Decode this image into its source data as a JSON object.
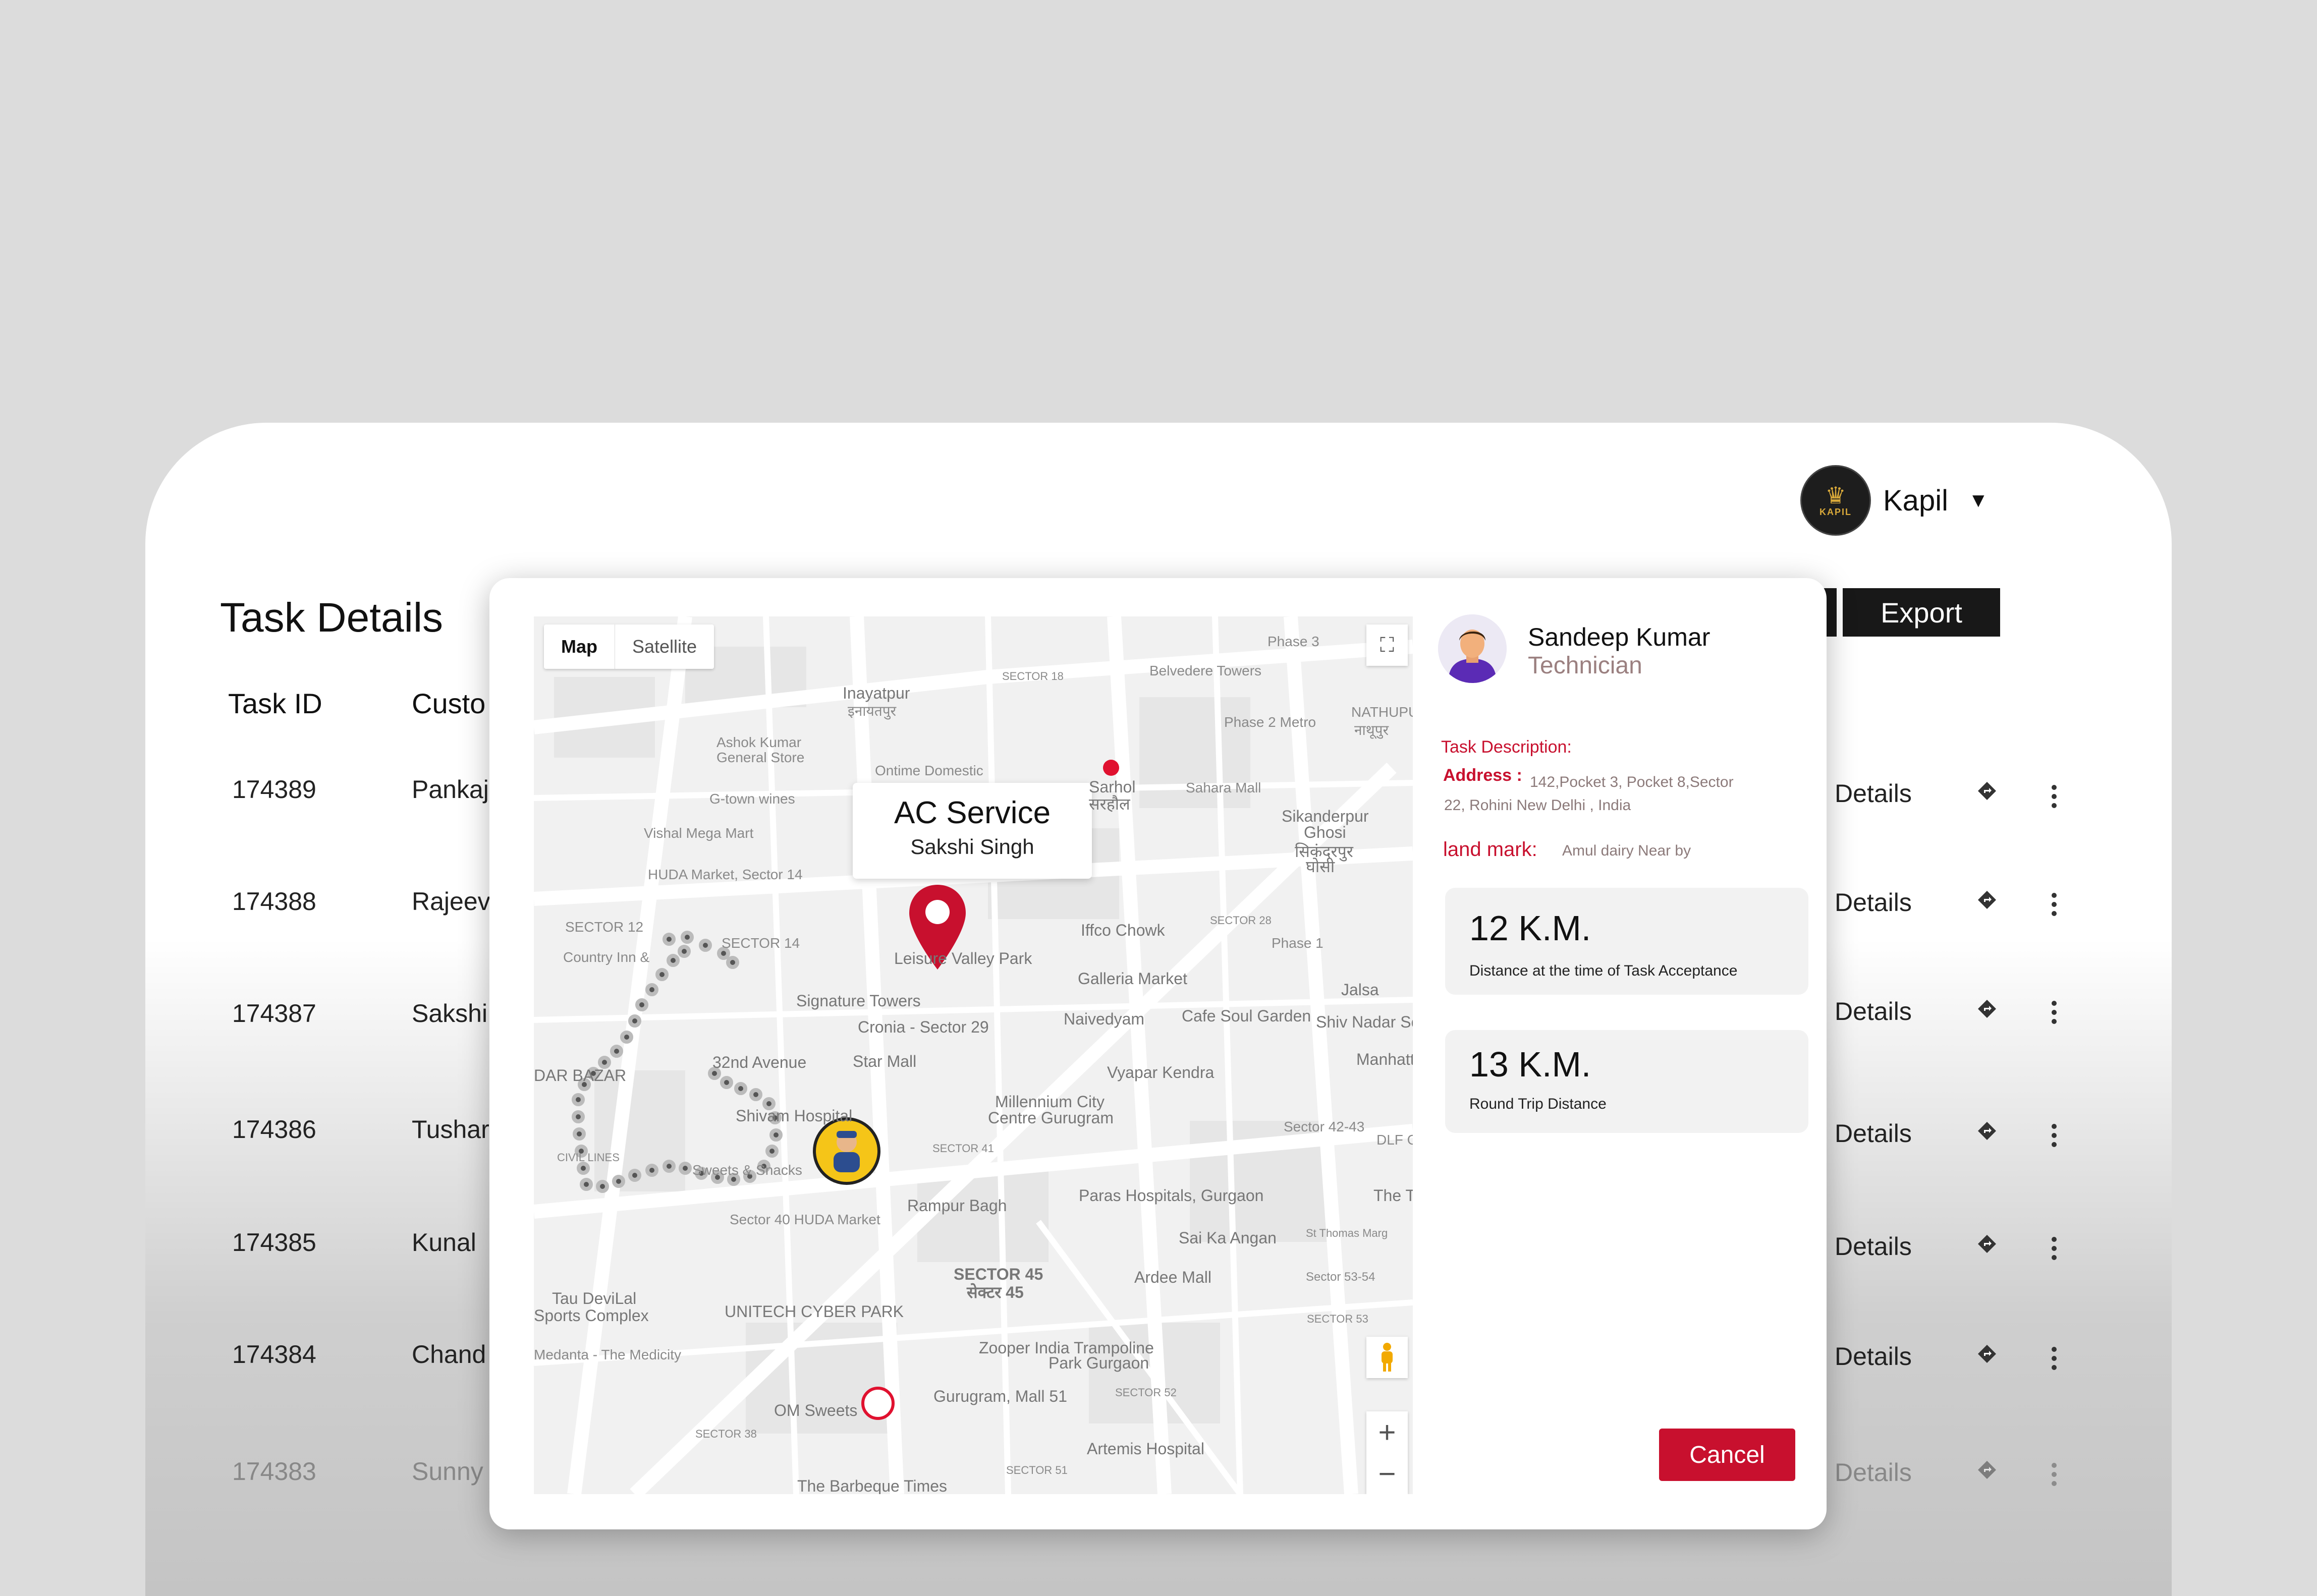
{
  "header": {
    "user_name": "Kapil",
    "logo_text": "KAPIL"
  },
  "page": {
    "title": "Task Details",
    "export_label": "Export"
  },
  "table": {
    "columns": [
      "Task ID",
      "Custo"
    ],
    "rows": [
      {
        "id": "174389",
        "customer": "Pankaj",
        "link": "Details"
      },
      {
        "id": "174388",
        "customer": "Rajeev",
        "link": "Details"
      },
      {
        "id": "174387",
        "customer": "Sakshi",
        "link": "Details"
      },
      {
        "id": "174386",
        "customer": "Tushar",
        "link": "Details"
      },
      {
        "id": "174385",
        "customer": "Kunal",
        "link": "Details"
      },
      {
        "id": "174384",
        "customer": "Chand",
        "link": "Details"
      },
      {
        "id": "174383",
        "customer": "Sunny",
        "link": "Details"
      }
    ]
  },
  "map": {
    "type_map": "Map",
    "type_satellite": "Satellite",
    "callout_title": "AC Service",
    "callout_subtitle": "Sakshi Singh",
    "zoom_in": "+",
    "zoom_out": "−",
    "labels": [
      "Inayatpur",
      "इनायतपुर",
      "Ashok Kumar",
      "General Store",
      "Ontime Domestic",
      "G-town wines",
      "Vishal Mega Mart",
      "HUDA Market, Sector 14",
      "SECTOR 12",
      "SECTOR 14",
      "Country Inn &",
      "Signature Towers",
      "Cronia - Sector 29",
      "32nd Avenue",
      "Star Mall",
      "Shivam Hospital",
      "DAR BAZAR",
      "Sweets & Snacks",
      "Sector 40 HUDA Market",
      "Tau DeviLal",
      "Sports Complex",
      "UNITECH CYBER PARK",
      "Medanta - The Medicity",
      "OM Sweets",
      "Zooper India Trampoline",
      "Park Gurgaon",
      "Artemis Hospital",
      "The Barbeque Times",
      "SECTOR 45",
      "सेक्टर 45",
      "Paras Hospitals, Gurgaon",
      "Millennium City",
      "Centre Gurugram",
      "Sai Ka Angan",
      "Ardee Mall",
      "Vyapar Kendra",
      "Naivedyam",
      "Cafe Soul Garden",
      "Galleria Market",
      "Iffco Chowk",
      "Sikanderpur",
      "Ghosi",
      "सिकंदरपुर",
      "घोसी",
      "Sahara Mall",
      "Sarhol",
      "सरहौल",
      "Phase 2 Metro",
      "Belvedere Towers",
      "SECTOR 18",
      "SECTOR 28",
      "Phase 1",
      "Jalsa",
      "Shiv Nadar Sch",
      "Sector 42-43",
      "DLF G",
      "NATHUPUR",
      "नाथूपुर",
      "Phase 3",
      "SECTOR 52",
      "SECTOR 53",
      "SECTOR 38",
      "Gurugram, Mall 51",
      "SECTOR 51",
      "CIVIL LINES",
      "SECTOR 41",
      "Rampur Bagh",
      "Leisure Valley Park",
      "Manhattan & Brewery",
      "The Two",
      "St Thomas Marg",
      "Sector 53-54"
    ]
  },
  "technician": {
    "name": "Sandeep Kumar",
    "role": "Technician",
    "task_desc_label": "Task Description:",
    "address_label": "Address :",
    "address_value": "142,Pocket 3, Pocket 8,Sector",
    "address_value_2": "22, Rohini New Delhi , India",
    "landmark_label": "land mark:",
    "landmark_value": "Amul dairy Near by"
  },
  "stats": [
    {
      "value": "12 K.M.",
      "label": "Distance at the time of Task Acceptance"
    },
    {
      "value": "13 K.M.",
      "label": "Round Trip Distance"
    }
  ],
  "actions": {
    "cancel_label": "Cancel"
  },
  "colors": {
    "accent": "#c8102e",
    "dark_button": "#181818"
  }
}
